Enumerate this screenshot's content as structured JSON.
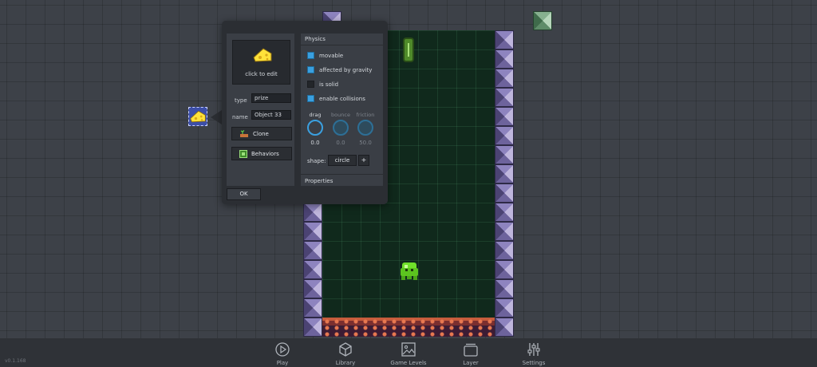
{
  "inspector": {
    "thumbnail_label": "click to edit",
    "type_label": "type",
    "type_value": "prize",
    "name_label": "name",
    "name_value": "Object 33",
    "clone_label": "Clone",
    "behaviors_label": "Behaviors",
    "ok_label": "OK",
    "physics": {
      "title": "Physics",
      "checkboxes": [
        {
          "label": "movable",
          "checked": true
        },
        {
          "label": "affected by gravity",
          "checked": true
        },
        {
          "label": "is solid",
          "checked": false
        },
        {
          "label": "enable collisions",
          "checked": true
        }
      ],
      "knobs": [
        {
          "label": "drag",
          "value": "0.0"
        },
        {
          "label": "bounce",
          "value": "0.0"
        },
        {
          "label": "friction",
          "value": "50.0"
        }
      ],
      "shape_label": "shape:",
      "shape_value": "circle",
      "shape_add": "+"
    },
    "properties_title": "Properties"
  },
  "toolbar": {
    "items": [
      {
        "label": "Play",
        "icon": "play-icon"
      },
      {
        "label": "Library",
        "icon": "cube-icon"
      },
      {
        "label": "Game Levels",
        "icon": "image-icon"
      },
      {
        "label": "Layer",
        "icon": "layers-icon"
      },
      {
        "label": "Settings",
        "icon": "sliders-icon"
      }
    ]
  },
  "version": "v0.1.168",
  "colors": {
    "accent": "#3aa0e0",
    "background": "#3d4148",
    "panel": "#2b2e33",
    "level": "#10291c"
  }
}
